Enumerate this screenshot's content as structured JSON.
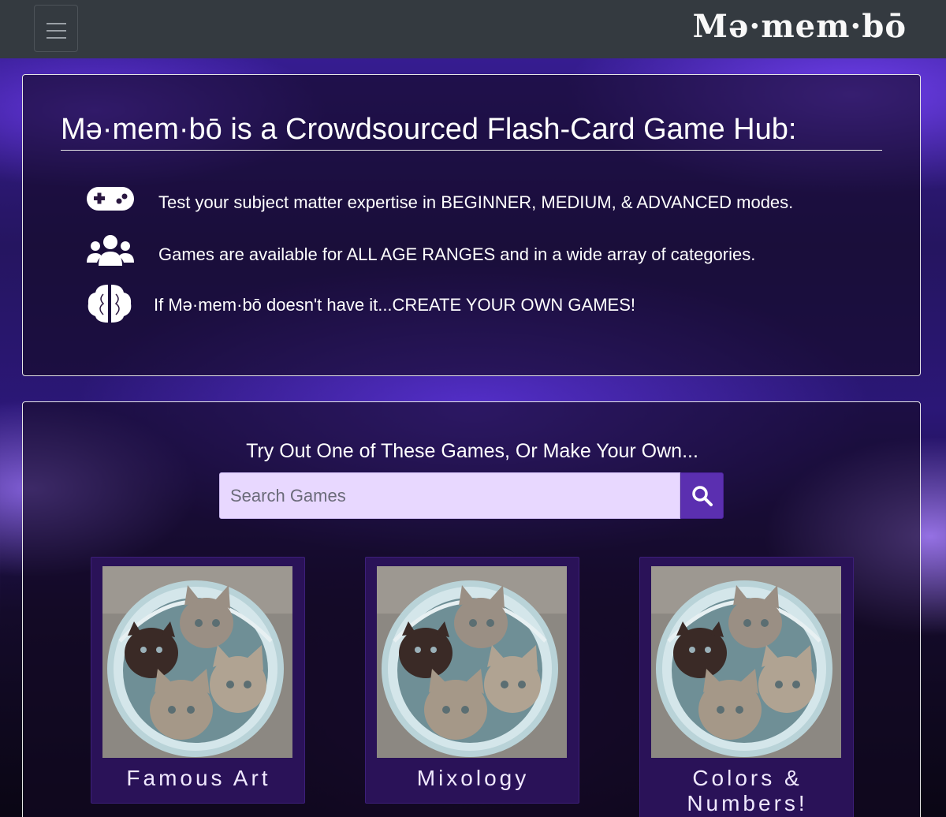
{
  "navbar": {
    "brand": "Mə·mem·bō",
    "toggle_icon": "hamburger-menu-icon"
  },
  "about": {
    "title": "Mə·mem·bō is a Crowdsourced Flash-Card Game Hub:",
    "features": [
      {
        "icon": "gamepad-icon",
        "text": "Test your subject matter expertise in BEGINNER, MEDIUM, & ADVANCED modes."
      },
      {
        "icon": "users-icon",
        "text": "Games are available for ALL AGE RANGES and in a wide array of categories."
      },
      {
        "icon": "brain-icon",
        "text": "If Mə·mem·bō doesn't have it...CREATE YOUR OWN GAMES!"
      }
    ]
  },
  "games": {
    "heading": "Try Out One of These Games, Or Make Your Own...",
    "search": {
      "placeholder": "Search Games",
      "value": "",
      "button_icon": "search-icon"
    },
    "cards": [
      {
        "title": "Famous Art",
        "image": "kittens-in-bucket"
      },
      {
        "title": "Mixology",
        "image": "kittens-in-bucket"
      },
      {
        "title": "Colors & Numbers!",
        "image": "kittens-in-bucket"
      }
    ]
  },
  "colors": {
    "navbar_bg": "#343a40",
    "search_bg": "#e8d8ff",
    "search_button": "#5b2fb0",
    "card_bg": "#2a1258"
  }
}
